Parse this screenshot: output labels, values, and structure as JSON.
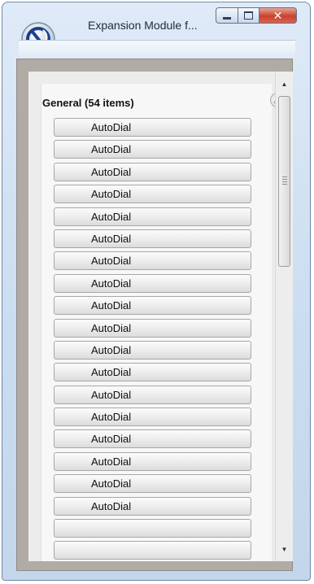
{
  "window": {
    "title": "Expansion Module f...",
    "controls": {
      "minimize": "minimize",
      "maximize": "maximize",
      "close": "close"
    }
  },
  "group": {
    "header": "General (54 items)",
    "collapse_icon": "double-chevron-up-icon"
  },
  "items": [
    "AutoDial",
    "AutoDial",
    "AutoDial",
    "AutoDial",
    "AutoDial",
    "AutoDial",
    "AutoDial",
    "AutoDial",
    "AutoDial",
    "AutoDial",
    "AutoDial",
    "AutoDial",
    "AutoDial",
    "AutoDial",
    "AutoDial",
    "AutoDial",
    "AutoDial",
    "AutoDial",
    "",
    "",
    ""
  ],
  "scrollbar": {
    "position_fraction": 0.0
  },
  "colors": {
    "title_bar": "#c9dcf0",
    "close_button": "#c9412c",
    "frame": "#b0aba4"
  }
}
